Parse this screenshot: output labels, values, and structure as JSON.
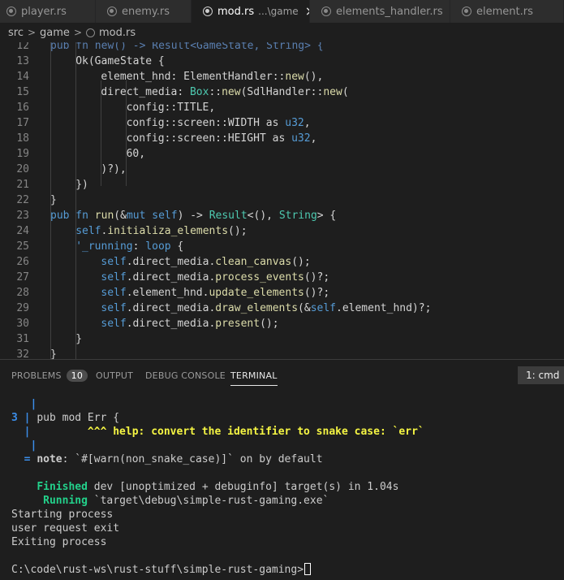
{
  "tabs": [
    {
      "name": "player.rs",
      "description": "",
      "active": false
    },
    {
      "name": "enemy.rs",
      "description": "",
      "active": false
    },
    {
      "name": "mod.rs",
      "description": "...\\game",
      "active": true
    },
    {
      "name": "elements_handler.rs",
      "description": "",
      "active": false
    },
    {
      "name": "element.rs",
      "description": "",
      "active": false
    }
  ],
  "breadcrumb": [
    "src",
    "game",
    "mod.rs"
  ],
  "editor": {
    "lines": [
      {
        "num": "12",
        "indent": 4,
        "tokens": [
          [
            "pub fn ",
            "t-dim"
          ],
          [
            "new",
            "t-dim"
          ],
          [
            "() -> ",
            "t-dim"
          ],
          [
            "Result",
            "t-dim"
          ],
          [
            "<GameState, ",
            "t-dim"
          ],
          [
            "String",
            "t-dim"
          ],
          [
            "> {",
            "t-dim"
          ]
        ]
      },
      {
        "num": "13",
        "indent": 8,
        "tokens": [
          [
            "Ok",
            "t-txt"
          ],
          [
            "(GameState {",
            "t-txt"
          ]
        ]
      },
      {
        "num": "14",
        "indent": 12,
        "tokens": [
          [
            "element_hnd",
            "t-txt"
          ],
          [
            ": ElementHandler::",
            "t-txt"
          ],
          [
            "new",
            "t-fn"
          ],
          [
            "(),",
            "t-txt"
          ]
        ]
      },
      {
        "num": "15",
        "indent": 12,
        "tokens": [
          [
            "direct_media",
            "t-txt"
          ],
          [
            ": ",
            "t-txt"
          ],
          [
            "Box",
            "t-ty"
          ],
          [
            "::",
            "t-txt"
          ],
          [
            "new",
            "t-fn"
          ],
          [
            "(SdlHandler::",
            "t-txt"
          ],
          [
            "new",
            "t-fn"
          ],
          [
            "(",
            "t-txt"
          ]
        ]
      },
      {
        "num": "16",
        "indent": 16,
        "tokens": [
          [
            "config::",
            "t-txt"
          ],
          [
            "TITLE",
            "t-txt"
          ],
          [
            ",",
            "t-txt"
          ]
        ]
      },
      {
        "num": "17",
        "indent": 16,
        "tokens": [
          [
            "config::screen::",
            "t-txt"
          ],
          [
            "WIDTH",
            "t-txt"
          ],
          [
            " as ",
            "t-txt"
          ],
          [
            "u32",
            "t-kw"
          ],
          [
            ",",
            "t-txt"
          ]
        ]
      },
      {
        "num": "18",
        "indent": 16,
        "tokens": [
          [
            "config::screen::",
            "t-txt"
          ],
          [
            "HEIGHT",
            "t-txt"
          ],
          [
            " as ",
            "t-txt"
          ],
          [
            "u32",
            "t-kw"
          ],
          [
            ",",
            "t-txt"
          ]
        ]
      },
      {
        "num": "19",
        "indent": 16,
        "tokens": [
          [
            "60",
            "t-txt"
          ],
          [
            ",",
            "t-txt"
          ]
        ]
      },
      {
        "num": "20",
        "indent": 12,
        "tokens": [
          [
            ")?),",
            "t-txt"
          ]
        ]
      },
      {
        "num": "21",
        "indent": 8,
        "tokens": [
          [
            "})",
            "t-txt"
          ]
        ]
      },
      {
        "num": "22",
        "indent": 4,
        "tokens": [
          [
            "}",
            "t-txt"
          ]
        ]
      },
      {
        "num": "23",
        "indent": 4,
        "tokens": [
          [
            "pub fn ",
            "t-kw"
          ],
          [
            "run",
            "t-fn"
          ],
          [
            "(&",
            "t-txt"
          ],
          [
            "mut ",
            "t-kw"
          ],
          [
            "self",
            "t-kw"
          ],
          [
            ") -> ",
            "t-txt"
          ],
          [
            "Result",
            "t-ty"
          ],
          [
            "<(), ",
            "t-txt"
          ],
          [
            "String",
            "t-ty"
          ],
          [
            "> {",
            "t-txt"
          ]
        ]
      },
      {
        "num": "24",
        "indent": 8,
        "tokens": [
          [
            "self",
            "t-kw"
          ],
          [
            ".",
            "t-txt"
          ],
          [
            "initializa_elements",
            "t-fn"
          ],
          [
            "();",
            "t-txt"
          ]
        ]
      },
      {
        "num": "25",
        "indent": 8,
        "tokens": [
          [
            "'_running",
            "t-lbl"
          ],
          [
            ": ",
            "t-txt"
          ],
          [
            "loop",
            "t-kw"
          ],
          [
            " {",
            "t-txt"
          ]
        ]
      },
      {
        "num": "26",
        "indent": 12,
        "tokens": [
          [
            "self",
            "t-kw"
          ],
          [
            ".direct_media.",
            "t-txt"
          ],
          [
            "clean_canvas",
            "t-fn"
          ],
          [
            "();",
            "t-txt"
          ]
        ]
      },
      {
        "num": "27",
        "indent": 12,
        "tokens": [
          [
            "self",
            "t-kw"
          ],
          [
            ".direct_media.",
            "t-txt"
          ],
          [
            "process_events",
            "t-fn"
          ],
          [
            "()?;",
            "t-txt"
          ]
        ]
      },
      {
        "num": "28",
        "indent": 12,
        "tokens": [
          [
            "self",
            "t-kw"
          ],
          [
            ".element_hnd.",
            "t-txt"
          ],
          [
            "update_elements",
            "t-fn"
          ],
          [
            "()?;",
            "t-txt"
          ]
        ]
      },
      {
        "num": "29",
        "indent": 12,
        "tokens": [
          [
            "self",
            "t-kw"
          ],
          [
            ".direct_media.",
            "t-txt"
          ],
          [
            "draw_elements",
            "t-fn"
          ],
          [
            "(&",
            "t-txt"
          ],
          [
            "self",
            "t-kw"
          ],
          [
            ".element_hnd)?;",
            "t-txt"
          ]
        ]
      },
      {
        "num": "30",
        "indent": 12,
        "tokens": [
          [
            "self",
            "t-kw"
          ],
          [
            ".direct_media.",
            "t-txt"
          ],
          [
            "present",
            "t-fn"
          ],
          [
            "();",
            "t-txt"
          ]
        ]
      },
      {
        "num": "31",
        "indent": 8,
        "tokens": [
          [
            "}",
            "t-txt"
          ]
        ]
      },
      {
        "num": "32",
        "indent": 4,
        "tokens": [
          [
            "}",
            "t-txt"
          ]
        ]
      }
    ]
  },
  "panel": {
    "tabs": [
      {
        "label": "PROBLEMS",
        "badge": "10",
        "active": false
      },
      {
        "label": "OUTPUT",
        "active": false
      },
      {
        "label": "DEBUG CONSOLE",
        "active": false
      },
      {
        "label": "TERMINAL",
        "active": true
      }
    ],
    "terminal_selector": "1: cmd"
  },
  "terminal": {
    "lines": [
      [
        [
          "   |",
          "c-blue c-bold"
        ]
      ],
      [
        [
          "3 | ",
          "c-blue c-bold"
        ],
        [
          "pub mod Err {",
          ""
        ]
      ],
      [
        [
          "  | ",
          "c-blue c-bold"
        ],
        [
          "        ^^^ help: convert the identifier to snake case: `err`",
          "c-yel c-bold"
        ]
      ],
      [
        [
          "   |",
          "c-blue c-bold"
        ]
      ],
      [
        [
          "  = ",
          "c-blue c-bold"
        ],
        [
          "note",
          "c-bold"
        ],
        [
          ": `#[warn(non_snake_case)]` on by default",
          ""
        ]
      ],
      [
        [
          "",
          ""
        ]
      ],
      [
        [
          "    ",
          ""
        ],
        [
          "Finished",
          "c-grn c-bold"
        ],
        [
          " dev [unoptimized + debuginfo] target(s) in 1.04s",
          ""
        ]
      ],
      [
        [
          "     ",
          ""
        ],
        [
          "Running",
          "c-grn c-bold"
        ],
        [
          " `target\\debug\\simple-rust-gaming.exe`",
          ""
        ]
      ],
      [
        [
          "Starting process",
          ""
        ]
      ],
      [
        [
          "user request exit",
          ""
        ]
      ],
      [
        [
          "Exiting process",
          ""
        ]
      ],
      [
        [
          "",
          ""
        ]
      ],
      [
        [
          "C:\\code\\rust-ws\\rust-stuff\\simple-rust-gaming>",
          ""
        ]
      ]
    ]
  },
  "colors": {
    "editor_bg": "#1e1e1e",
    "keyword": "#569cd6",
    "function": "#dcdcaa",
    "type": "#4ec9b0",
    "terminal_blue": "#3b8eea",
    "terminal_yellow": "#f5f543",
    "terminal_green": "#23d18b"
  }
}
